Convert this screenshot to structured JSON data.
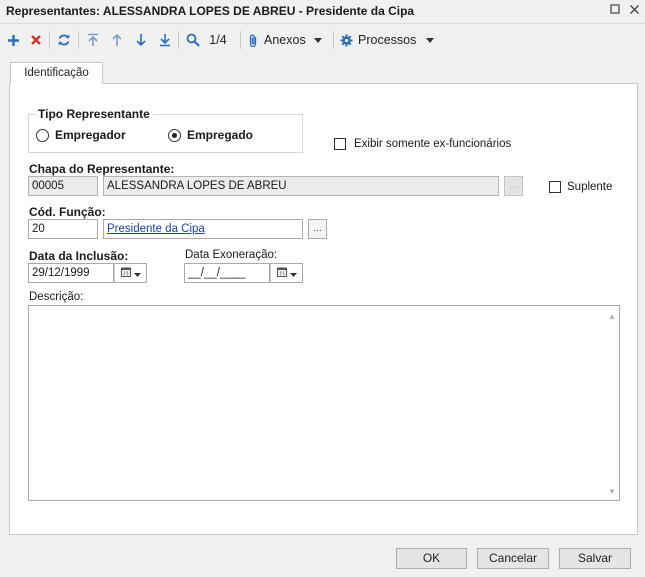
{
  "window": {
    "title": "Representantes: ALESSANDRA LOPES DE ABREU - Presidente da Cipa"
  },
  "toolbar": {
    "record_position": "1/4",
    "attachments_label": "Anexos",
    "processes_label": "Processos"
  },
  "tabs": [
    {
      "label": "Identificação",
      "active": true
    }
  ],
  "form": {
    "tipo_representante": {
      "legend": "Tipo Representante",
      "options": [
        {
          "label": "Empregador",
          "selected": false
        },
        {
          "label": "Empregado",
          "selected": true
        }
      ]
    },
    "exibir_ex_funcionarios": {
      "label": "Exibir somente ex-funcionários",
      "checked": false
    },
    "chapa": {
      "label": "Chapa do Representante:",
      "code": "00005",
      "name": "ALESSANDRA LOPES DE ABREU",
      "lookup": "..."
    },
    "suplente": {
      "label": "Suplente",
      "checked": false
    },
    "funcao": {
      "label": "Cód. Função:",
      "code": "20",
      "name": "Presidente da Cipa",
      "lookup": "..."
    },
    "data_inclusao": {
      "label": "Data da Inclusão:",
      "value": "29/12/1999"
    },
    "data_exoneracao": {
      "label": "Data Exoneração:",
      "value": "__/__/____"
    },
    "descricao": {
      "label": "Descrição:",
      "value": ""
    }
  },
  "footer": {
    "ok_label": "OK",
    "cancel_label": "Cancelar",
    "save_label": "Salvar"
  },
  "colors": {
    "toolbar_icon_blue": "#2a6db8",
    "delete_red": "#d03030",
    "link_blue": "#1a3fb0"
  }
}
